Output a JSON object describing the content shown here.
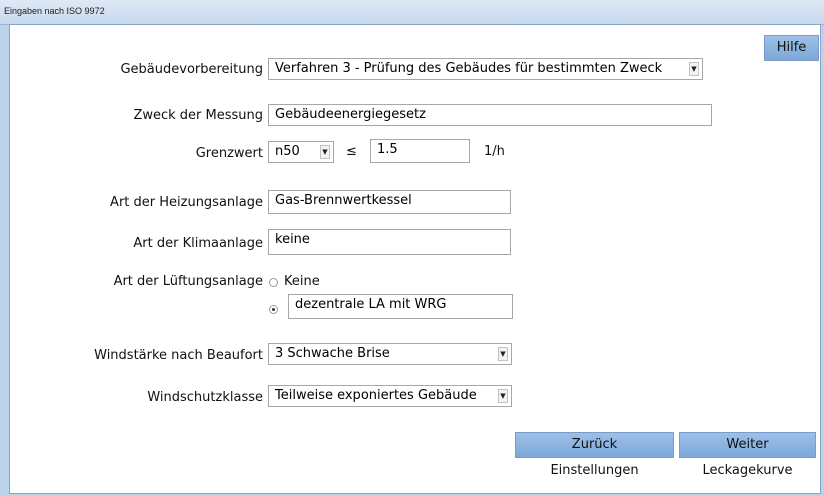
{
  "window": {
    "title": "Eingaben nach ISO 9972"
  },
  "help_button": "Hilfe",
  "form": {
    "gebaeudevorbereitung": {
      "label": "Gebäudevorbereitung",
      "value": "Verfahren 3 - Prüfung des Gebäudes für bestimmten Zweck"
    },
    "zweck": {
      "label": "Zweck der Messung",
      "value": "Gebäudeenergiegesetz"
    },
    "grenzwert": {
      "label": "Grenzwert",
      "type_value": "n50",
      "operator": "≤",
      "value": "1.5",
      "unit": "1/h"
    },
    "heizung": {
      "label": "Art der Heizungsanlage",
      "value": "Gas-Brennwertkessel"
    },
    "klima": {
      "label": "Art der Klimaanlage",
      "value": "keine"
    },
    "lueftung": {
      "label": "Art der Lüftungsanlage",
      "option_none": "Keine",
      "option_other_value": "dezentrale LA mit WRG",
      "selected": "other"
    },
    "wind": {
      "label": "Windstärke nach Beaufort",
      "value": "3  Schwache Brise"
    },
    "windschutz": {
      "label": "Windschutzklasse",
      "value": "Teilweise exponiertes Gebäude"
    }
  },
  "nav": {
    "back": {
      "label": "Zurück",
      "sub": "Einstellungen"
    },
    "next": {
      "label": "Weiter",
      "sub": "Leckagekurve"
    }
  }
}
